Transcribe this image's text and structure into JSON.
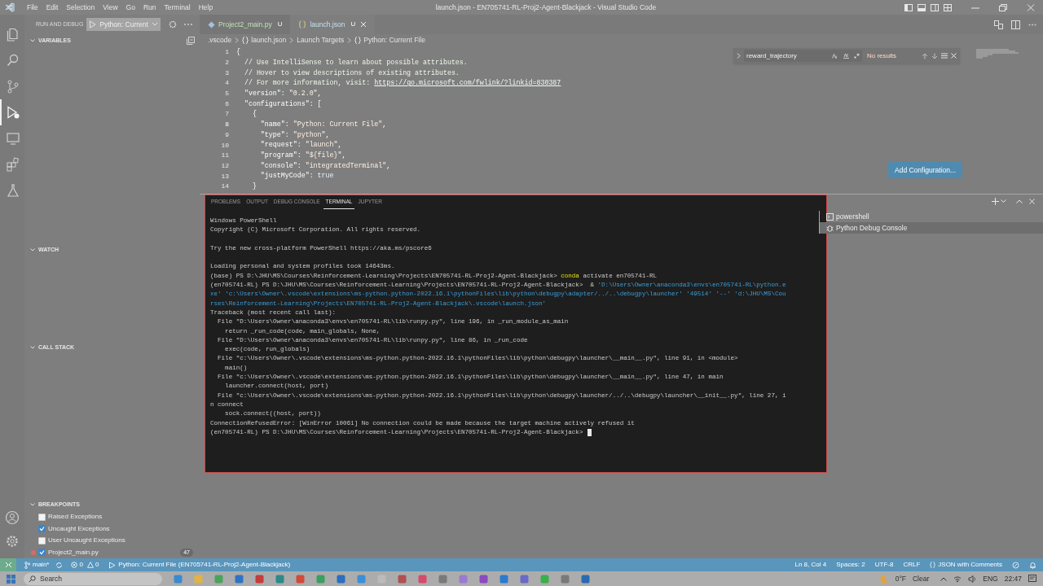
{
  "title_bar": {
    "menu": [
      "File",
      "Edit",
      "Selection",
      "View",
      "Go",
      "Run",
      "Terminal",
      "Help"
    ],
    "title": "launch.json - EN705741-RL-Proj2-Agent-Blackjack - Visual Studio Code"
  },
  "activity_bar": {
    "items": [
      {
        "kind": "explorer",
        "selected": false
      },
      {
        "kind": "search",
        "selected": false
      },
      {
        "kind": "source-control",
        "selected": false
      },
      {
        "kind": "run-debug",
        "selected": true
      },
      {
        "kind": "remote",
        "selected": false
      },
      {
        "kind": "extensions",
        "selected": false
      },
      {
        "kind": "testing",
        "selected": false
      }
    ],
    "bottom_items": [
      {
        "kind": "account"
      },
      {
        "kind": "settings"
      }
    ]
  },
  "sidebar": {
    "title": "RUN AND DEBUG",
    "configuration": "Python: Current",
    "sections": [
      {
        "title": "VARIABLES",
        "expanded": true
      },
      {
        "title": "WATCH",
        "expanded": true
      },
      {
        "title": "CALL STACK",
        "expanded": true
      },
      {
        "title": "BREAKPOINTS",
        "expanded": true,
        "items": [
          {
            "kind": "exception",
            "label": "Raised Exceptions",
            "checked": false
          },
          {
            "kind": "exception",
            "label": "Uncaught Exceptions",
            "checked": true
          },
          {
            "kind": "exception",
            "label": "User Uncaught Exceptions",
            "checked": false
          },
          {
            "kind": "file",
            "label": "Project2_main.py",
            "checked": true,
            "line": "47"
          }
        ]
      }
    ]
  },
  "editor": {
    "tabs": [
      {
        "label": "Project2_main.py",
        "status": "U",
        "kind": "python",
        "selected": false
      },
      {
        "label": "launch.json",
        "status": "U",
        "kind": "json",
        "selected": true
      }
    ],
    "breadcrumbs": [
      {
        "label": ".vscode",
        "kind": "folder"
      },
      {
        "label": "launch.json",
        "kind": "json"
      },
      {
        "label": "Launch Targets",
        "kind": "plain"
      },
      {
        "label": "Python: Current File",
        "kind": "json"
      }
    ],
    "lines": [
      {
        "number": "1",
        "current": false,
        "tokens": [
          {
            "kind": "punct",
            "text": "{"
          }
        ]
      },
      {
        "number": "2",
        "current": false,
        "tokens": [
          {
            "kind": "comment",
            "text": "  // Use IntelliSense to learn about possible attributes."
          }
        ]
      },
      {
        "number": "3",
        "current": false,
        "tokens": [
          {
            "kind": "comment",
            "text": "  // Hover to view descriptions of existing attributes."
          }
        ]
      },
      {
        "number": "4",
        "current": false,
        "tokens": [
          {
            "kind": "comment",
            "text": "  // For more information, visit: "
          },
          {
            "kind": "link",
            "text": "https://go.microsoft.com/fwlink/?linkid=830387"
          }
        ]
      },
      {
        "number": "5",
        "current": false,
        "tokens": [
          {
            "kind": "key",
            "text": "  \"version\""
          },
          {
            "kind": "punct",
            "text": ": "
          },
          {
            "kind": "string",
            "text": "\"0.2.0\""
          },
          {
            "kind": "punct",
            "text": ","
          }
        ]
      },
      {
        "number": "6",
        "current": false,
        "tokens": [
          {
            "kind": "key",
            "text": "  \"configurations\""
          },
          {
            "kind": "punct",
            "text": ": ["
          }
        ]
      },
      {
        "number": "7",
        "current": false,
        "tokens": [
          {
            "kind": "punct",
            "text": "    {"
          }
        ]
      },
      {
        "number": "8",
        "current": true,
        "tokens": [
          {
            "kind": "key",
            "text": "      \"name\""
          },
          {
            "kind": "punct",
            "text": ": "
          },
          {
            "kind": "string",
            "text": "\"Python: Current File\""
          },
          {
            "kind": "punct",
            "text": ","
          }
        ]
      },
      {
        "number": "9",
        "current": false,
        "tokens": [
          {
            "kind": "key",
            "text": "      \"type\""
          },
          {
            "kind": "punct",
            "text": ": "
          },
          {
            "kind": "string",
            "text": "\"python\""
          },
          {
            "kind": "punct",
            "text": ","
          }
        ]
      },
      {
        "number": "10",
        "current": false,
        "tokens": [
          {
            "kind": "key",
            "text": "      \"request\""
          },
          {
            "kind": "punct",
            "text": ": "
          },
          {
            "kind": "string",
            "text": "\"launch\""
          },
          {
            "kind": "punct",
            "text": ","
          }
        ]
      },
      {
        "number": "11",
        "current": false,
        "tokens": [
          {
            "kind": "key",
            "text": "      \"program\""
          },
          {
            "kind": "punct",
            "text": ": "
          },
          {
            "kind": "string",
            "text": "\"${file}\""
          },
          {
            "kind": "punct",
            "text": ","
          }
        ]
      },
      {
        "number": "12",
        "current": false,
        "tokens": [
          {
            "kind": "key",
            "text": "      \"console\""
          },
          {
            "kind": "punct",
            "text": ": "
          },
          {
            "kind": "string",
            "text": "\"integratedTerminal\""
          },
          {
            "kind": "punct",
            "text": ","
          }
        ]
      },
      {
        "number": "13",
        "current": false,
        "tokens": [
          {
            "kind": "key",
            "text": "      \"justMyCode\""
          },
          {
            "kind": "punct",
            "text": ": "
          },
          {
            "kind": "keyword",
            "text": "true"
          }
        ]
      },
      {
        "number": "14",
        "current": false,
        "tokens": [
          {
            "kind": "punct",
            "text": "    }"
          }
        ]
      }
    ],
    "find": {
      "query": "reward_trajectory",
      "result": "No results"
    },
    "add_button": "Add Configuration..."
  },
  "panel": {
    "tabs": [
      {
        "label": "PROBLEMS",
        "selected": false
      },
      {
        "label": "OUTPUT",
        "selected": false
      },
      {
        "label": "DEBUG CONSOLE",
        "selected": false
      },
      {
        "label": "TERMINAL",
        "selected": true
      },
      {
        "label": "JUPYTER",
        "selected": false
      }
    ],
    "terminal_lines": [
      {
        "kind": "text",
        "segments": [
          {
            "kind": "plain",
            "text": "Windows PowerShell"
          }
        ]
      },
      {
        "kind": "text",
        "segments": [
          {
            "kind": "plain",
            "text": "Copyright (C) Microsoft Corporation. All rights reserved."
          }
        ]
      },
      {
        "kind": "blank"
      },
      {
        "kind": "text",
        "segments": [
          {
            "kind": "plain",
            "text": "Try the new cross-platform PowerShell https://aka.ms/pscore6"
          }
        ]
      },
      {
        "kind": "blank"
      },
      {
        "kind": "text",
        "segments": [
          {
            "kind": "plain",
            "text": "Loading personal and system profiles took 14643ms."
          }
        ]
      },
      {
        "kind": "text",
        "segments": [
          {
            "kind": "plain",
            "text": "(base) PS D:\\JHU\\MS\\Courses\\Reinforcement-Learning\\Projects\\EN705741-RL-Proj2-Agent-Blackjack> "
          },
          {
            "kind": "command",
            "text": "conda"
          },
          {
            "kind": "plain",
            "text": " activate en705741-RL"
          }
        ]
      },
      {
        "kind": "text",
        "segments": [
          {
            "kind": "plain",
            "text": "(en705741-RL) PS D:\\JHU\\MS\\Courses\\Reinforcement-Learning\\Projects\\EN705741-RL-Proj2-Agent-Blackjack>  & "
          },
          {
            "kind": "path",
            "text": "'D:\\Users\\Owner\\anaconda3\\envs\\en705741-RL\\python.e"
          }
        ]
      },
      {
        "kind": "text",
        "segments": [
          {
            "kind": "path",
            "text": "xe' 'c:\\Users\\Owner\\.vscode\\extensions\\ms-python.python-2022.16.1\\pythonFiles\\lib\\python\\debugpy\\adapter/../..\\debugpy\\launcher' '49514' '--' 'd:\\JHU\\MS\\Cou"
          }
        ]
      },
      {
        "kind": "text",
        "segments": [
          {
            "kind": "path",
            "text": "rses\\Reinforcement-Learning\\Projects\\EN705741-RL-Proj2-Agent-Blackjack\\.vscode\\launch.json'"
          }
        ]
      },
      {
        "kind": "text",
        "segments": [
          {
            "kind": "plain",
            "text": "Traceback (most recent call last):"
          }
        ]
      },
      {
        "kind": "text",
        "segments": [
          {
            "kind": "plain",
            "text": "  File \"D:\\Users\\Owner\\anaconda3\\envs\\en705741-RL\\lib\\runpy.py\", line 196, in _run_module_as_main"
          }
        ]
      },
      {
        "kind": "text",
        "segments": [
          {
            "kind": "plain",
            "text": "    return _run_code(code, main_globals, None,"
          }
        ]
      },
      {
        "kind": "text",
        "segments": [
          {
            "kind": "plain",
            "text": "  File \"D:\\Users\\Owner\\anaconda3\\envs\\en705741-RL\\lib\\runpy.py\", line 86, in _run_code"
          }
        ]
      },
      {
        "kind": "text",
        "segments": [
          {
            "kind": "plain",
            "text": "    exec(code, run_globals)"
          }
        ]
      },
      {
        "kind": "text",
        "segments": [
          {
            "kind": "plain",
            "text": "  File \"c:\\Users\\Owner\\.vscode\\extensions\\ms-python.python-2022.16.1\\pythonFiles\\lib\\python\\debugpy\\launcher\\__main__.py\", line 91, in <module>"
          }
        ]
      },
      {
        "kind": "text",
        "segments": [
          {
            "kind": "plain",
            "text": "    main()"
          }
        ]
      },
      {
        "kind": "text",
        "segments": [
          {
            "kind": "plain",
            "text": "  File \"c:\\Users\\Owner\\.vscode\\extensions\\ms-python.python-2022.16.1\\pythonFiles\\lib\\python\\debugpy\\launcher\\__main__.py\", line 47, in main"
          }
        ]
      },
      {
        "kind": "text",
        "segments": [
          {
            "kind": "plain",
            "text": "    launcher.connect(host, port)"
          }
        ]
      },
      {
        "kind": "text",
        "segments": [
          {
            "kind": "plain",
            "text": "  File \"c:\\Users\\Owner\\.vscode\\extensions\\ms-python.python-2022.16.1\\pythonFiles\\lib\\python\\debugpy\\launcher/../..\\debugpy\\launcher\\__init__.py\", line 27, i"
          }
        ]
      },
      {
        "kind": "text",
        "segments": [
          {
            "kind": "plain",
            "text": "n connect"
          }
        ]
      },
      {
        "kind": "text",
        "segments": [
          {
            "kind": "plain",
            "text": "    sock.connect((host, port))"
          }
        ]
      },
      {
        "kind": "text",
        "segments": [
          {
            "kind": "plain",
            "text": "ConnectionRefusedError: [WinError 10061] No connection could be made because the target machine actively refused it"
          }
        ]
      },
      {
        "kind": "prompt",
        "segments": [
          {
            "kind": "plain",
            "text": "(en705741-RL) PS D:\\JHU\\MS\\Courses\\Reinforcement-Learning\\Projects\\EN705741-RL-Proj2-Agent-Blackjack> "
          }
        ]
      }
    ],
    "terminals": [
      {
        "label": "powershell",
        "kind": "shell",
        "selected": false
      },
      {
        "label": "Python Debug Console",
        "kind": "debug",
        "selected": true
      }
    ]
  },
  "status_bar": {
    "branch": "main*",
    "errors": "0",
    "warnings": "0",
    "debug_target": "Python: Current File (EN705741-RL-Proj2-Agent-Blackjack)",
    "right": [
      "Ln 8, Col 4",
      "Spaces: 2",
      "UTF-8",
      "CRLF"
    ],
    "language": "JSON with Comments"
  },
  "taskbar": {
    "search": "Search",
    "temperature": "0°F",
    "condition": "Clear",
    "language": "ENG",
    "time": "22:47"
  }
}
